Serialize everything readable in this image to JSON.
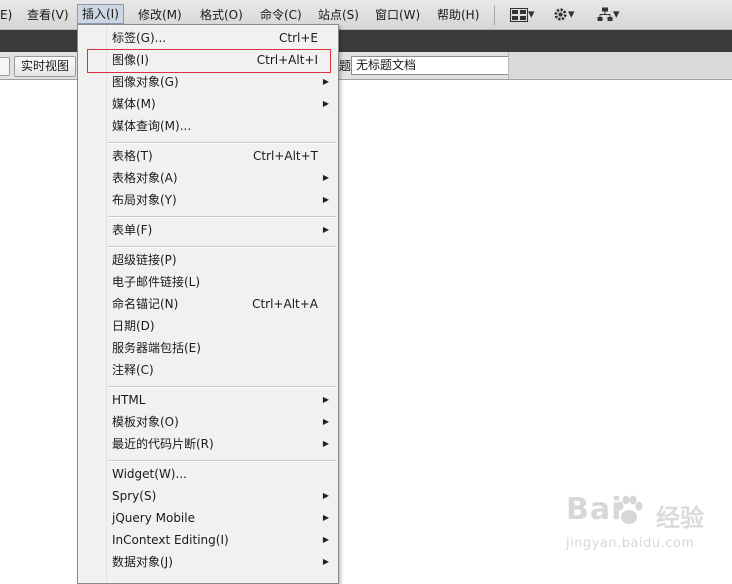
{
  "menubar": {
    "items": [
      "E)",
      "查看(V)",
      "插入(I)",
      "修改(M)",
      "格式(O)",
      "命令(C)",
      "站点(S)",
      "窗口(W)",
      "帮助(H)"
    ],
    "active_index": 2,
    "icons": [
      "layout-icon",
      "gear-icon",
      "site-icon"
    ],
    "dropdown_glyph": "▾"
  },
  "doc_toolbar": {
    "live_view_label": "实时视图",
    "title_label": "题:",
    "title_value": "无标题文档"
  },
  "insert_menu": {
    "items": [
      {
        "label": "标签(G)...",
        "shortcut": "Ctrl+E",
        "submenu": false
      },
      {
        "label": "图像(I)",
        "shortcut": "Ctrl+Alt+I",
        "submenu": false,
        "highlighted": true
      },
      {
        "label": "图像对象(G)",
        "shortcut": "",
        "submenu": true
      },
      {
        "label": "媒体(M)",
        "shortcut": "",
        "submenu": true
      },
      {
        "label": "媒体查询(M)...",
        "shortcut": "",
        "submenu": false
      },
      {
        "label": "表格(T)",
        "shortcut": "Ctrl+Alt+T",
        "submenu": false
      },
      {
        "label": "表格对象(A)",
        "shortcut": "",
        "submenu": true
      },
      {
        "label": "布局对象(Y)",
        "shortcut": "",
        "submenu": true
      },
      {
        "label": "表单(F)",
        "shortcut": "",
        "submenu": true
      },
      {
        "label": "超级链接(P)",
        "shortcut": "",
        "submenu": false
      },
      {
        "label": "电子邮件链接(L)",
        "shortcut": "",
        "submenu": false
      },
      {
        "label": "命名锚记(N)",
        "shortcut": "Ctrl+Alt+A",
        "submenu": false
      },
      {
        "label": "日期(D)",
        "shortcut": "",
        "submenu": false
      },
      {
        "label": "服务器端包括(E)",
        "shortcut": "",
        "submenu": false
      },
      {
        "label": "注释(C)",
        "shortcut": "",
        "submenu": false
      },
      {
        "label": "HTML",
        "shortcut": "",
        "submenu": true
      },
      {
        "label": "模板对象(O)",
        "shortcut": "",
        "submenu": true
      },
      {
        "label": "最近的代码片断(R)",
        "shortcut": "",
        "submenu": true
      },
      {
        "label": "Widget(W)...",
        "shortcut": "",
        "submenu": false
      },
      {
        "label": "Spry(S)",
        "shortcut": "",
        "submenu": true
      },
      {
        "label": "jQuery Mobile",
        "shortcut": "",
        "submenu": true
      },
      {
        "label": "InContext Editing(I)",
        "shortcut": "",
        "submenu": true
      },
      {
        "label": "数据对象(J)",
        "shortcut": "",
        "submenu": true
      }
    ],
    "submenu_arrow": "▶"
  },
  "watermark": {
    "logo_text": "Bai",
    "logo_text2": "经验",
    "url": "jingyan.baidu.com"
  },
  "colors": {
    "highlight_border": "#d9323e",
    "menu_active_bg": "#cdd7e3"
  }
}
